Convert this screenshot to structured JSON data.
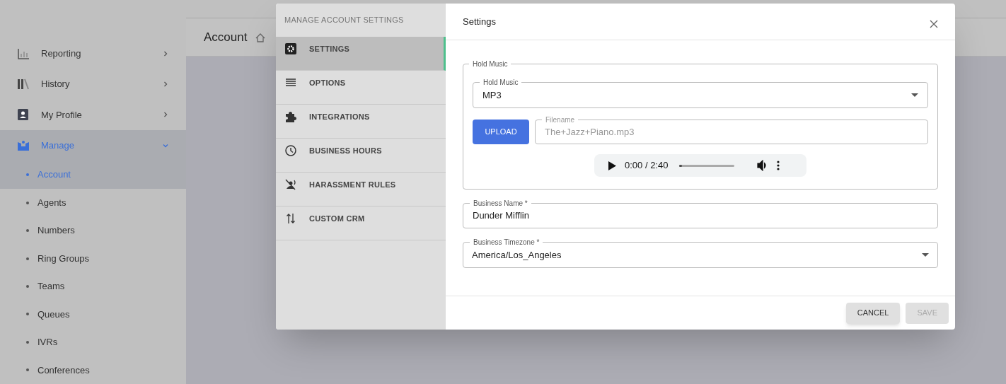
{
  "sidebar": {
    "items": [
      {
        "label": "Reporting",
        "expanded": false,
        "selected": false
      },
      {
        "label": "History",
        "expanded": false,
        "selected": false
      },
      {
        "label": "My Profile",
        "expanded": false,
        "selected": false
      },
      {
        "label": "Manage",
        "expanded": true,
        "selected": true,
        "children": [
          {
            "label": "Account",
            "selected": true
          },
          {
            "label": "Agents",
            "selected": false
          },
          {
            "label": "Numbers",
            "selected": false
          },
          {
            "label": "Ring Groups",
            "selected": false
          },
          {
            "label": "Teams",
            "selected": false
          },
          {
            "label": "Queues",
            "selected": false
          },
          {
            "label": "IVRs",
            "selected": false
          },
          {
            "label": "Conferences",
            "selected": false
          }
        ]
      }
    ]
  },
  "page": {
    "title": "Account"
  },
  "dialog": {
    "menu_title": "MANAGE ACCOUNT SETTINGS",
    "menu": [
      {
        "label": "SETTINGS",
        "selected": true
      },
      {
        "label": "OPTIONS",
        "selected": false
      },
      {
        "label": "INTEGRATIONS",
        "selected": false
      },
      {
        "label": "BUSINESS HOURS",
        "selected": false
      },
      {
        "label": "HARASSMENT RULES",
        "selected": false
      },
      {
        "label": "CUSTOM CRM",
        "selected": false
      }
    ],
    "title": "Settings",
    "hold_music": {
      "legend": "Hold Music",
      "select_label": "Hold Music",
      "select_value": "MP3",
      "upload_button": "UPLOAD",
      "filename_label": "Filename",
      "filename_placeholder": "The+Jazz+Piano.mp3",
      "player": {
        "time": "0:00 / 2:40",
        "level": 0
      }
    },
    "business_name": {
      "label": "Business Name *",
      "value": "Dunder Mifflin"
    },
    "timezone": {
      "label": "Business Timezone *",
      "value": "America/Los_Angeles"
    },
    "buttons": [
      {
        "label": "CANCEL",
        "disabled": false
      },
      {
        "label": "SAVE",
        "disabled": true
      }
    ]
  }
}
